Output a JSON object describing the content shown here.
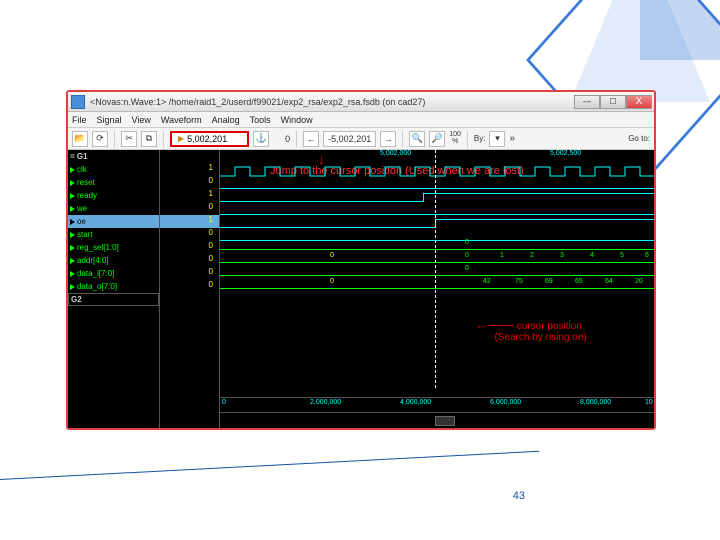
{
  "slide": {
    "page_num": "43"
  },
  "window": {
    "title": "<Novas:n.Wave:1> /home/raid1_2/userd/f99021/exp2_rsa/exp2_rsa.fsdb (on cad27)",
    "min": "—",
    "max": "☐",
    "close": "X"
  },
  "menu": [
    "File",
    "Signal",
    "View",
    "Waveform",
    "Analog",
    "Tools",
    "Window"
  ],
  "toolbar": {
    "cursor_pos": "5,002,201",
    "time_neg": "-5,002,201",
    "zoom_pct": "100\n%",
    "by_label": "By:",
    "goto_label": "Go to:"
  },
  "ruler_top": {
    "t0": "5,002,000",
    "t1": "5,002,500"
  },
  "ruler_bot": {
    "t0": "0",
    "t1": "2,000,000",
    "t2": "4,000,000",
    "t3": "6,000,000",
    "t4": "8,000,000",
    "t5": "10"
  },
  "annot": {
    "jump": "Jump to the cursor position (Used when we are lost)",
    "cursor1": "cursor position",
    "cursor2": "(Search by rising oe)"
  },
  "signals": {
    "g1": "= G1",
    "items": [
      {
        "name": "clk",
        "val": "1"
      },
      {
        "name": "reset",
        "val": "0"
      },
      {
        "name": "ready",
        "val": "1"
      },
      {
        "name": "we",
        "val": "0"
      },
      {
        "name": "oe",
        "val": "1",
        "hl": true
      },
      {
        "name": "start",
        "val": "0"
      },
      {
        "name": "reg_sel[1:0]",
        "val": "0"
      },
      {
        "name": "addr[4:0]",
        "val": "0"
      },
      {
        "name": "data_i[7:0]",
        "val": "0"
      },
      {
        "name": "data_o[7:0]",
        "val": "0"
      }
    ],
    "g2": "G2"
  },
  "bus_labels": {
    "regsel": [
      "0"
    ],
    "addr_vals": [
      "0",
      "0",
      "1",
      "2",
      "3",
      "4",
      "5",
      "6"
    ],
    "datai": [
      "0"
    ],
    "datao_vals": [
      "0",
      "42",
      "75",
      "69",
      "65",
      "64",
      "20"
    ]
  }
}
